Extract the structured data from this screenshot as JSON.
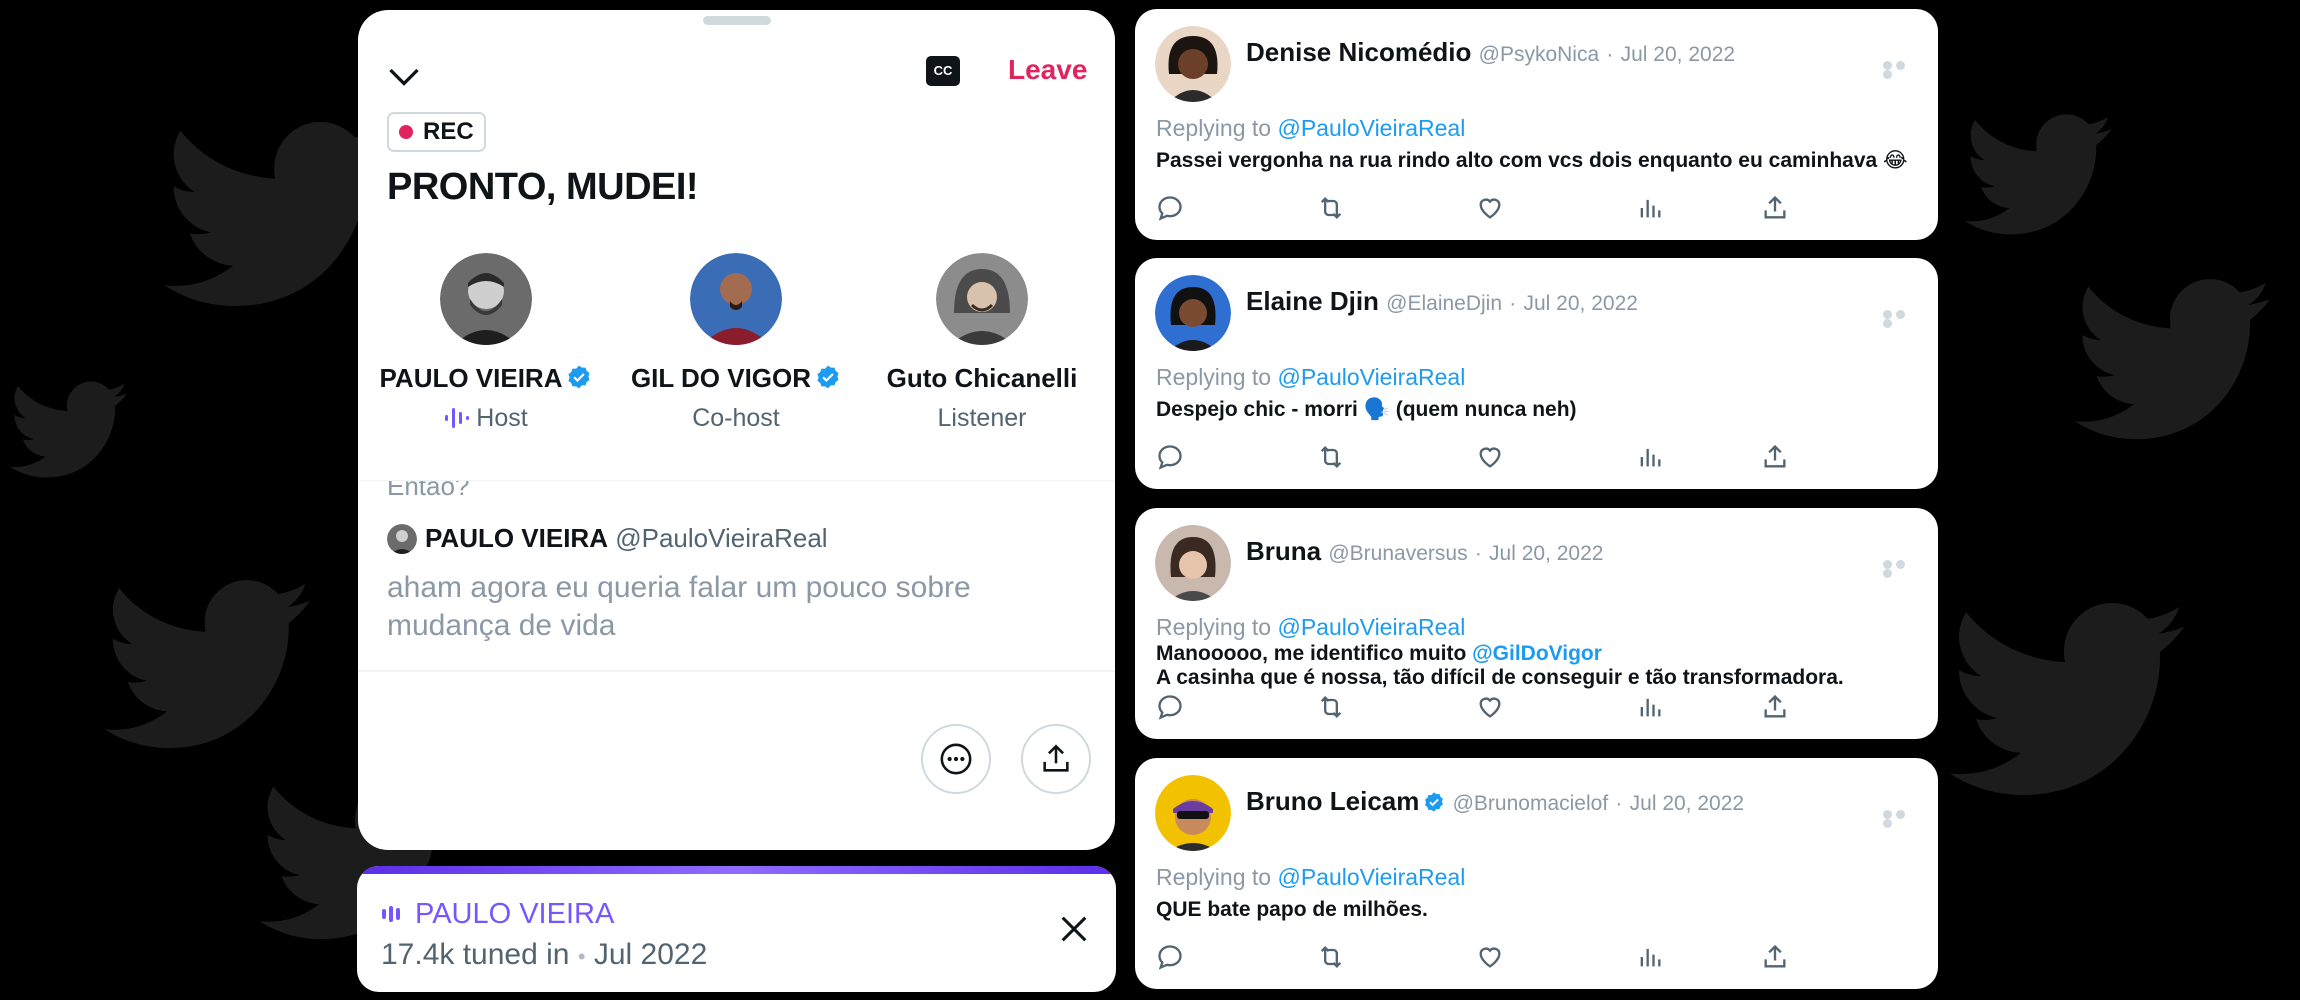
{
  "space": {
    "cc_label": "CC",
    "leave_label": "Leave",
    "rec_label": "REC",
    "title": "PRONTO, MUDEI!",
    "speakers": [
      {
        "name": "PAULO VIEIRA",
        "role": "Host",
        "verified": true
      },
      {
        "name": "GIL DO VIGOR",
        "role": "Co-host",
        "verified": true
      },
      {
        "name": "Guto Chicanelli",
        "role": "Listener",
        "verified": false
      }
    ],
    "caption": {
      "previous_text": "Então?",
      "speaker_name": "PAULO VIEIRA",
      "speaker_handle": "@PauloVieiraReal",
      "text": "aham agora eu queria falar um pouco sobre mudança de vida"
    }
  },
  "player": {
    "host_name": "PAULO VIEIRA",
    "tuned_in": "17.4k tuned in",
    "separator": "•",
    "date": "Jul 2022"
  },
  "tweets": [
    {
      "name": "Denise Nicomédio",
      "handle": "@PsykoNica",
      "separator": "·",
      "date": "Jul 20, 2022",
      "replying_label": "Replying to",
      "replying_to": "@PauloVieiraReal",
      "text": "Passei vergonha na rua rindo alto com vcs dois enquanto eu caminhava 😂"
    },
    {
      "name": "Elaine Djin",
      "handle": "@ElaineDjin",
      "separator": "·",
      "date": "Jul 20, 2022",
      "replying_label": "Replying to",
      "replying_to": "@PauloVieiraReal",
      "text": "Despejo chic - morri 🗣️ (quem nunca neh)"
    },
    {
      "name": "Bruna",
      "handle": "@Brunaversus",
      "separator": "·",
      "date": "Jul 20, 2022",
      "replying_label": "Replying to",
      "replying_to": "@PauloVieiraReal",
      "text_line1": "Manooooo, me identifico muito",
      "text_mention": "@GilDoVigor",
      "text_line2": "A casinha que é nossa, tão difícil de conseguir e tão transformadora."
    },
    {
      "name": "Bruno Leicam",
      "handle": "@Brunomacielof",
      "separator": "·",
      "date": "Jul 20, 2022",
      "replying_label": "Replying to",
      "replying_to": "@PauloVieiraReal",
      "text": "QUE bate papo de milhões."
    }
  ],
  "colors": {
    "background": "#000000",
    "leave": "#e0245e",
    "accent_purple": "#7856ff",
    "link_blue": "#1d9bf0",
    "verified_blue": "#1d9bf0"
  }
}
